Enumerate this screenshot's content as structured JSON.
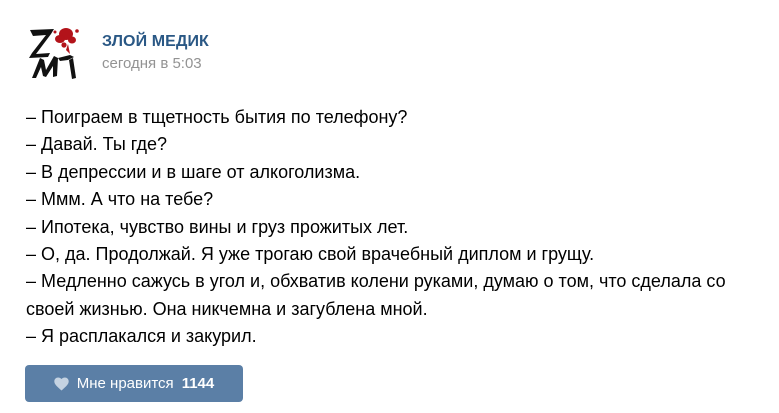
{
  "post": {
    "author": "ЗЛОЙ МЕДИК",
    "date": "сегодня в 5:03",
    "avatar": {
      "icon": "zm-logo-icon",
      "letters": "ZM",
      "colors": {
        "ink": "#111111",
        "blot": "#b3131a"
      }
    },
    "lines": [
      "– Поиграем в тщетность бытия по телефону?",
      "– Давай. Ты где?",
      "– В депрессии и в шаге от алкоголизма.",
      "– Ммм. А что на тебе?",
      "– Ипотека, чувство вины и груз прожитых лет.",
      "– О, да. Продолжай. Я уже трогаю свой врачебный диплом и грущу.",
      "– Медленно сажусь в угол и, обхватив колени руками, думаю о том, что сделала со",
      "своей жизнью. Она никчемна и загублена мной.",
      "– Я расплакался и закурил."
    ],
    "like": {
      "icon": "heart-icon",
      "label": "Мне нравится",
      "count": "1144"
    }
  },
  "colors": {
    "author": "#2a5885",
    "date": "#939393",
    "text": "#000000",
    "like_button": "#5b7fa6",
    "like_text": "#ffffff"
  }
}
